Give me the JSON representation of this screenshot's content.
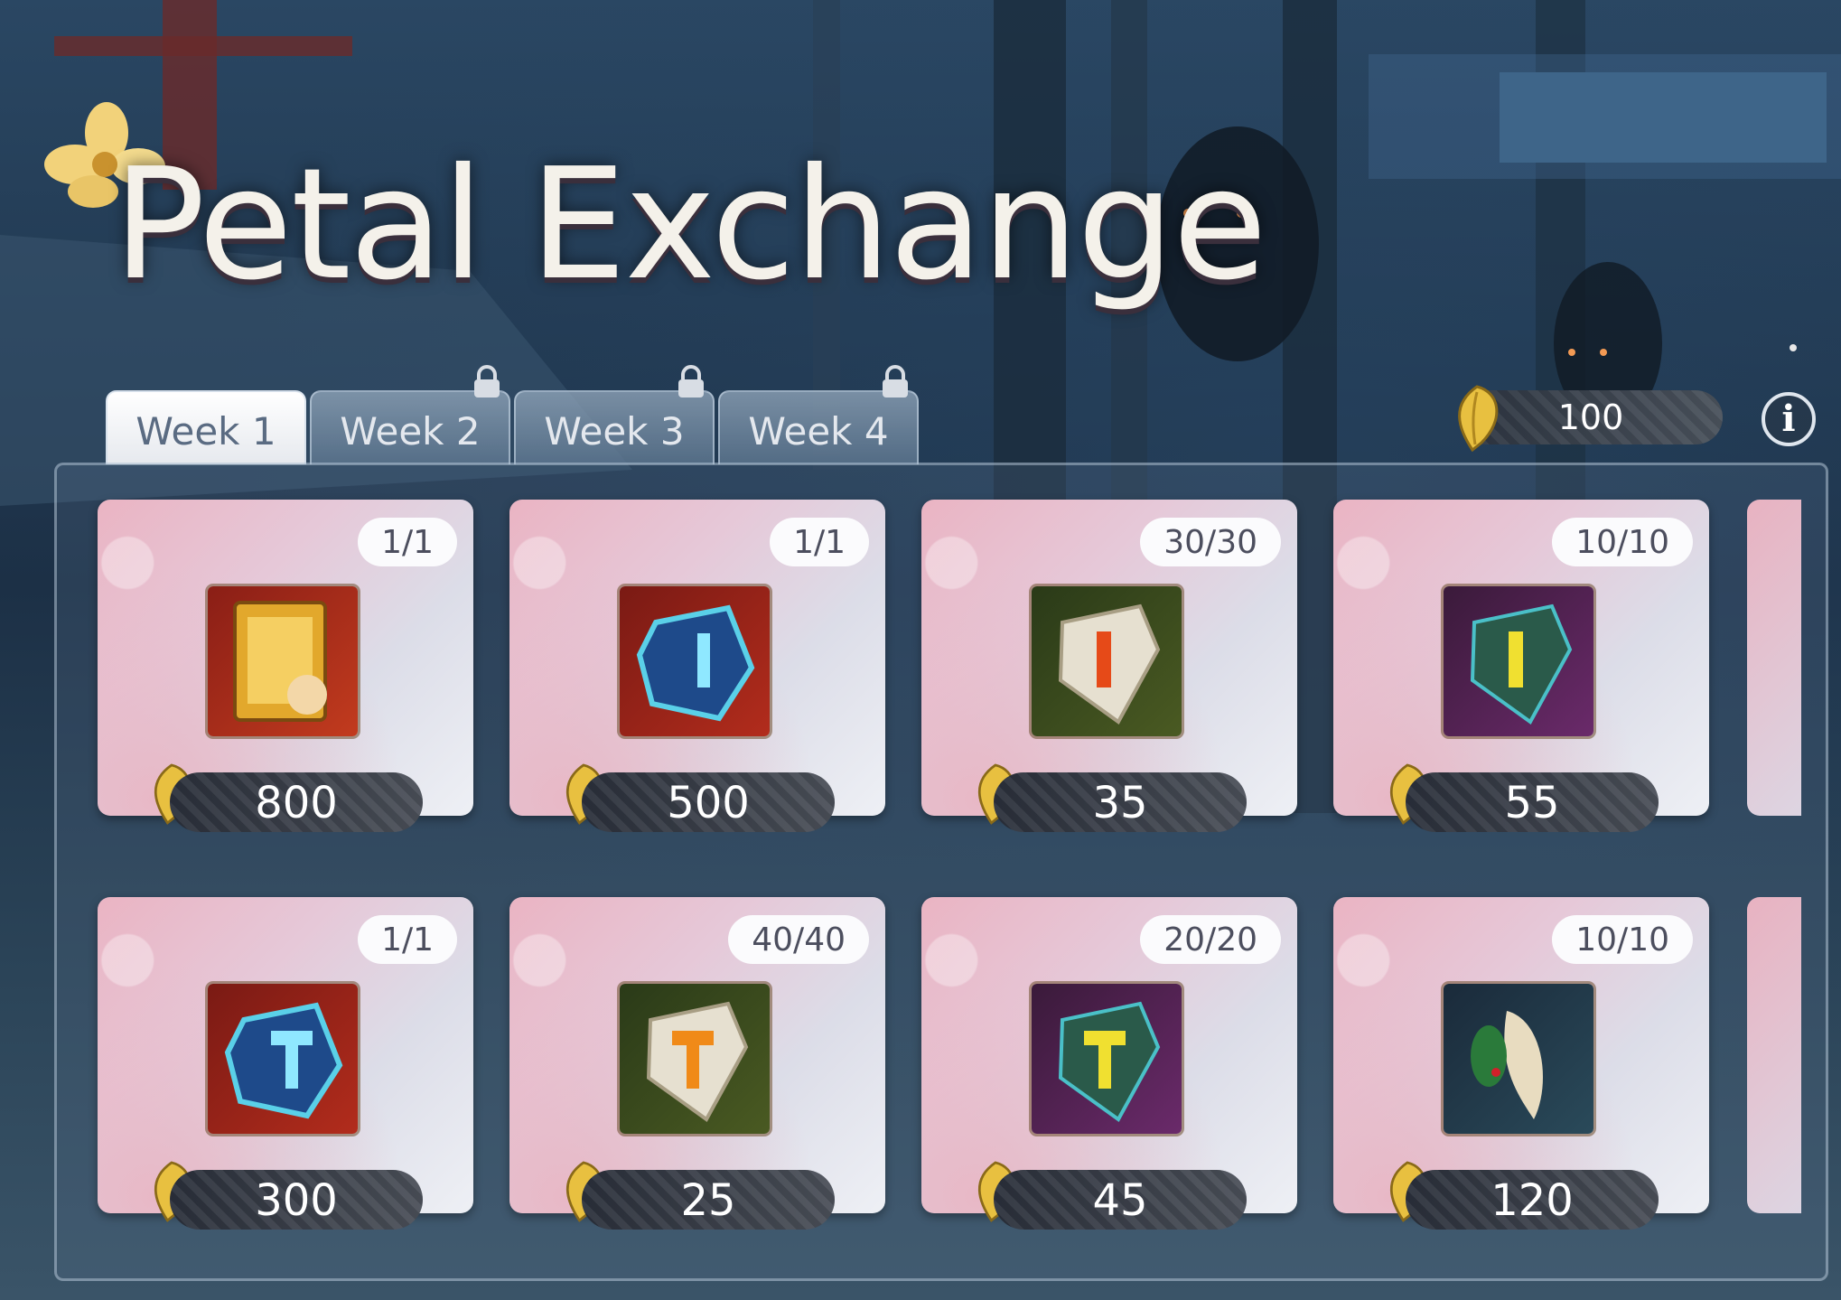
{
  "title": "Petal Exchange",
  "tabs": [
    {
      "label": "Week 1",
      "locked": false,
      "active": true
    },
    {
      "label": "Week 2",
      "locked": true,
      "active": false
    },
    {
      "label": "Week 3",
      "locked": true,
      "active": false
    },
    {
      "label": "Week 4",
      "locked": true,
      "active": false
    }
  ],
  "currency": {
    "icon": "golden-petal-icon",
    "amount": "100"
  },
  "info_icon": "info-icon",
  "colors": {
    "accent_pink": "#eab4c3",
    "price_bar": "#2a2f3a",
    "tab_active": "#ffffff"
  },
  "items": [
    {
      "stock": "1/1",
      "price": "800",
      "icon": "golden-book-icon"
    },
    {
      "stock": "1/1",
      "price": "500",
      "icon": "blue-transcendence-stone-icon"
    },
    {
      "stock": "30/30",
      "price": "35",
      "icon": "white-upgrade-stone-icon"
    },
    {
      "stock": "10/10",
      "price": "55",
      "icon": "rainbow-upgrade-stone-icon"
    },
    {
      "stock": "1/1",
      "price": "300",
      "icon": "blue-hammer-stone-icon"
    },
    {
      "stock": "40/40",
      "price": "25",
      "icon": "white-hammer-stone-icon"
    },
    {
      "stock": "20/20",
      "price": "45",
      "icon": "rainbow-hammer-stone-icon"
    },
    {
      "stock": "10/10",
      "price": "120",
      "icon": "ginseng-icon"
    }
  ]
}
